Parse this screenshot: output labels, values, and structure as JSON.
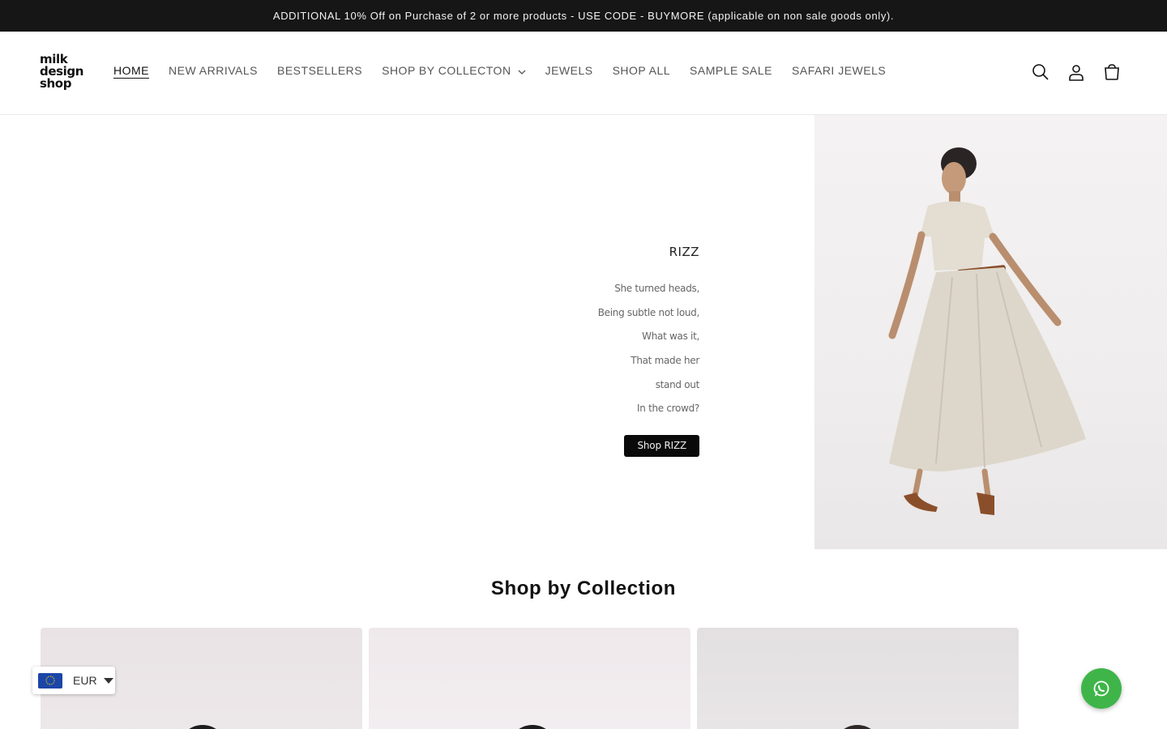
{
  "announcement": {
    "text": "ADDITIONAL 10% Off on Purchase of 2 or more products - USE CODE - BUYMORE (applicable on non sale goods only)."
  },
  "header": {
    "logo_lines": [
      "milk",
      "design",
      "shop"
    ],
    "nav": [
      {
        "label": "HOME",
        "active": true
      },
      {
        "label": "NEW ARRIVALS"
      },
      {
        "label": "BESTSELLERS"
      },
      {
        "label": "SHOP BY COLLECTON",
        "has_dropdown": true
      },
      {
        "label": "JEWELS"
      },
      {
        "label": "SHOP ALL"
      },
      {
        "label": "SAMPLE SALE"
      },
      {
        "label": "SAFARI JEWELS"
      }
    ],
    "icons": [
      "search-icon",
      "account-icon",
      "cart-icon"
    ]
  },
  "hero": {
    "title": "RIZZ",
    "lines": [
      "She turned heads,",
      "Being subtle not loud,",
      "What was it,",
      "That made her",
      "stand out",
      "In the crowd?"
    ],
    "cta_label": "Shop RIZZ"
  },
  "collections": {
    "title": "Shop by Collection"
  },
  "currency": {
    "code": "EUR",
    "flag": "eu-flag-icon"
  },
  "chat": {
    "icon": "whatsapp-icon"
  },
  "colors": {
    "announcement_bg": "#161616",
    "whatsapp_green": "#3fb549",
    "cta_bg": "#0a0a0a"
  }
}
